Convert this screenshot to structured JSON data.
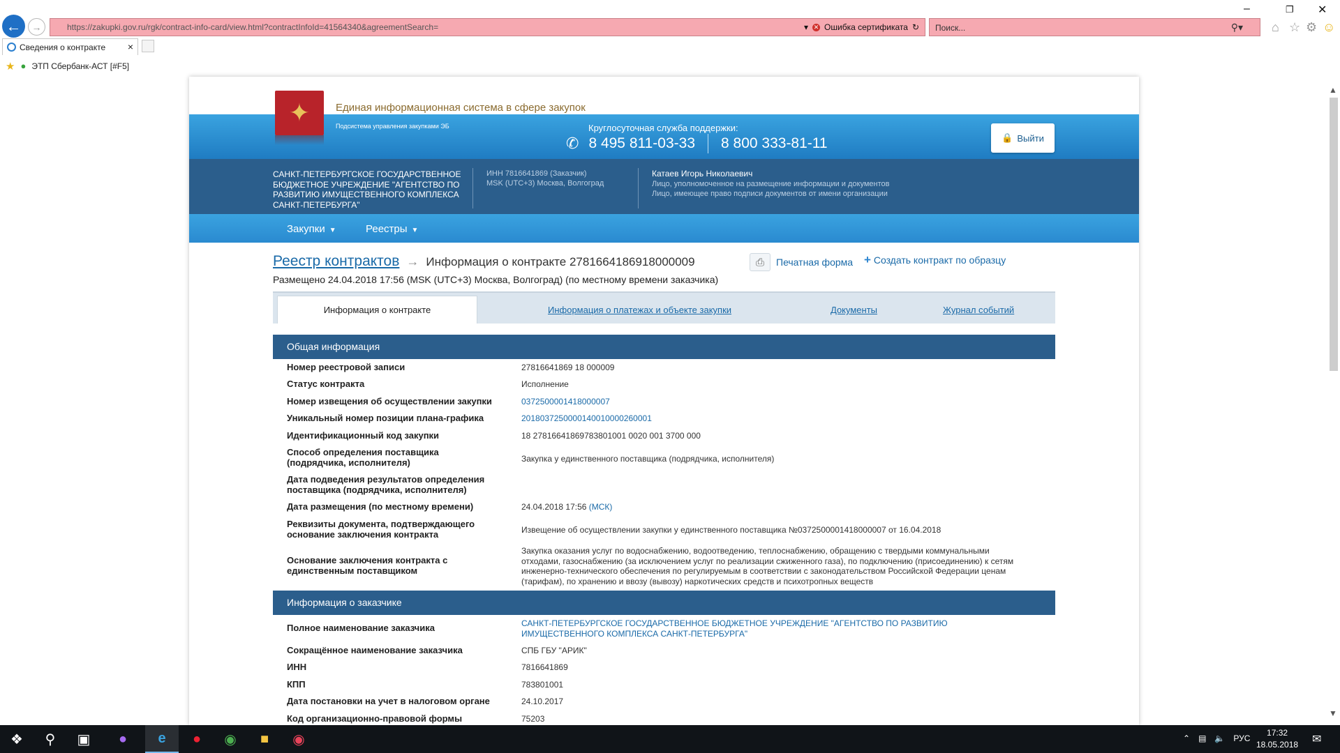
{
  "browser": {
    "url_host": "https://zakupki.gov.ru",
    "url_path": "/rgk/contract-info-card/view.html?contractInfoId=41564340&agreementSearch=",
    "cert_error": "Ошибка сертификата",
    "search_placeholder": "Поиск...",
    "tab_title": "Сведения о контракте",
    "favorite": "ЭТП Сбербанк-АСТ [#F5]"
  },
  "header": {
    "site_title": "Единая информационная система в сфере закупок",
    "subsystem": "Подсистема управления закупками ЭБ",
    "support_label": "Круглосуточная служба поддержки:",
    "phone1": "8 495 811-03-33",
    "phone2": "8 800 333-81-11",
    "logout": "Выйти"
  },
  "org": {
    "name": "САНКТ-ПЕТЕРБУРГСКОЕ ГОСУДАРСТВЕННОЕ БЮДЖЕТНОЕ УЧРЕЖДЕНИЕ \"АГЕНТСТВО ПО РАЗВИТИЮ ИМУЩЕСТВЕННОГО КОМПЛЕКСА САНКТ-ПЕТЕРБУРГА\"",
    "inn": "ИНН 7816641869 (Заказчик)",
    "tz": "MSK (UTC+3) Москва, Волгоград",
    "user_name": "Катаев Игорь Николаевич",
    "user_role1": "Лицо, уполномоченное на размещение информации и документов",
    "user_role2": "Лицо, имеющее право подписи документов от имени организации"
  },
  "nav": {
    "item1": "Закупки",
    "item2": "Реестры"
  },
  "breadcrumb": {
    "root": "Реестр контрактов",
    "current": "Информация о контракте 2781664186918000009",
    "placed": "Размещено 24.04.2018 17:56 (MSK (UTC+3) Москва, Волгоград) (по местному времени заказчика)",
    "print": "Печатная форма",
    "create": "Создать контракт по образцу"
  },
  "tabs": {
    "t1": "Информация о контракте",
    "t2": "Информация о платежах и объекте закупки",
    "t3": "Документы",
    "t4": "Журнал событий"
  },
  "general": {
    "title": "Общая информация",
    "rows": [
      {
        "label": "Номер реестровой записи",
        "value": "27816641869 18 000009"
      },
      {
        "label": "Статус контракта",
        "value": "Исполнение"
      },
      {
        "label": "Номер извещения об осуществлении закупки",
        "value": "0372500001418000007"
      },
      {
        "label": "Уникальный номер позиции плана-графика",
        "value": "2018037250000140010000260001"
      },
      {
        "label": "Идентификационный код закупки",
        "value": "18 27816641869783801001 0020 001 3700 000"
      },
      {
        "label": "Способ определения поставщика (подрядчика, исполнителя)",
        "value": "Закупка у единственного поставщика (подрядчика, исполнителя)"
      },
      {
        "label": "Дата подведения результатов определения поставщика (подрядчика, исполнителя)",
        "value": ""
      },
      {
        "label": "Дата размещения (по местному времени)",
        "value": "24.04.2018 17:56",
        "suffix": "(МСК)"
      },
      {
        "label": "Реквизиты документа, подтверждающего основание заключения контракта",
        "value": "Извещение об осуществлении закупки у единственного поставщика №0372500001418000007 от 16.04.2018"
      },
      {
        "label": "Основание заключения контракта с единственным поставщиком",
        "value": "Закупка оказания услуг по водоснабжению, водоотведению, теплоснабжению, обращению с твердыми коммунальными отходами, газоснабжению (за исключением услуг по реализации сжиженного газа), по подключению (присоединению) к сетям инженерно-технического обеспечения по регулируемым в соответствии с законодательством Российской Федерации ценам (тарифам), по хранению и ввозу (вывозу) наркотических средств и психотропных веществ"
      }
    ]
  },
  "customer": {
    "title": "Информация о заказчике",
    "rows": [
      {
        "label": "Полное наименование заказчика",
        "value": "САНКТ-ПЕТЕРБУРГСКОЕ ГОСУДАРСТВЕННОЕ БЮДЖЕТНОЕ УЧРЕЖДЕНИЕ \"АГЕНТСТВО ПО РАЗВИТИЮ ИМУЩЕСТВЕННОГО КОМПЛЕКСА САНКТ-ПЕТЕРБУРГА\""
      },
      {
        "label": "Сокращённое наименование заказчика",
        "value": "СПБ ГБУ \"АРИК\""
      },
      {
        "label": "ИНН",
        "value": "7816641869"
      },
      {
        "label": "КПП",
        "value": "783801001"
      },
      {
        "label": "Дата постановки на учет в налоговом органе",
        "value": "24.10.2017"
      },
      {
        "label": "Код организационно-правовой формы",
        "value": "75203"
      }
    ]
  },
  "taskbar": {
    "time": "17:32",
    "date": "18.05.2018",
    "lang": "РУС"
  },
  "colors": {
    "header_blue": "#2b5e8c",
    "accent_blue": "#2a8ad0",
    "link": "#1a6aa8",
    "cert_error_bg": "#f6a9b1"
  }
}
